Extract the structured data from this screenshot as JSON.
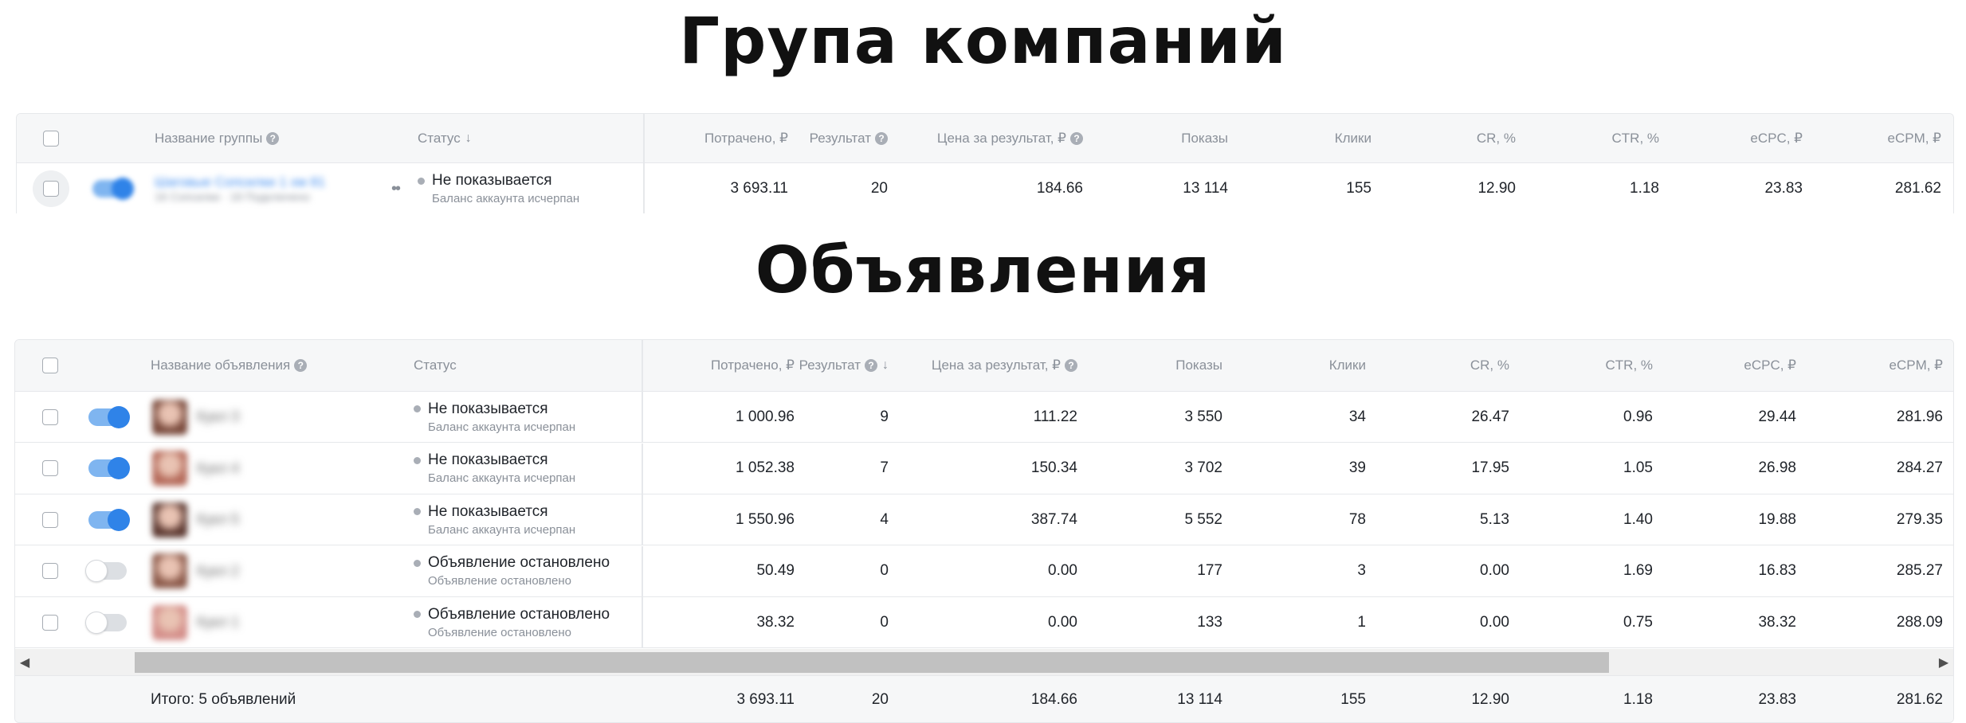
{
  "headings": {
    "campaign_groups": "Група компаний",
    "ads": "Объявления"
  },
  "groups_table": {
    "columns": {
      "name": "Название группы",
      "status": "Статус",
      "spent": "Потрачено, ₽",
      "result": "Результат",
      "price_per_result": "Цена за результат, ₽",
      "impressions": "Показы",
      "clicks": "Клики",
      "cr": "CR, %",
      "ctr": "CTR, %",
      "ecpc": "eCPC, ₽",
      "ecpm": "eCPM, ₽"
    },
    "sort_indicator": "↓",
    "rows": [
      {
        "name_blurred": "Шаговые Сопсилки 1 хм 81",
        "sub_blurred": "16 Сопсилки · 18 Подключено",
        "enabled": true,
        "status": "Не показывается",
        "status_sub": "Баланс аккаунта исчерпан",
        "spent": "3 693.11",
        "result": "20",
        "price_per_result": "184.66",
        "impressions": "13 114",
        "clicks": "155",
        "cr": "12.90",
        "ctr": "1.18",
        "ecpc": "23.83",
        "ecpm": "281.62"
      }
    ]
  },
  "ads_table": {
    "columns": {
      "name": "Название объявления",
      "status": "Статус",
      "spent": "Потрачено, ₽",
      "result": "Результат",
      "price_per_result": "Цена за результат, ₽",
      "impressions": "Показы",
      "clicks": "Клики",
      "cr": "CR, %",
      "ctr": "CTR, %",
      "ecpc": "eCPC, ₽",
      "ecpm": "eCPM, ₽"
    },
    "sort_indicator": "↓",
    "rows": [
      {
        "name_blurred": "Кукл 3",
        "thumb_color": "#7a4a3c",
        "enabled": true,
        "status": "Не показывается",
        "status_sub": "Баланс аккаунта исчерпан",
        "spent": "1 000.96",
        "result": "9",
        "price_per_result": "111.22",
        "impressions": "3 550",
        "clicks": "34",
        "cr": "26.47",
        "ctr": "0.96",
        "ecpc": "29.44",
        "ecpm": "281.96"
      },
      {
        "name_blurred": "Кукл 4",
        "thumb_color": "#b56a5a",
        "enabled": true,
        "status": "Не показывается",
        "status_sub": "Баланс аккаунта исчерпан",
        "spent": "1 052.38",
        "result": "7",
        "price_per_result": "150.34",
        "impressions": "3 702",
        "clicks": "39",
        "cr": "17.95",
        "ctr": "1.05",
        "ecpc": "26.98",
        "ecpm": "284.27"
      },
      {
        "name_blurred": "Кукл 5",
        "thumb_color": "#5e3a32",
        "enabled": true,
        "status": "Не показывается",
        "status_sub": "Баланс аккаунта исчерпан",
        "spent": "1 550.96",
        "result": "4",
        "price_per_result": "387.74",
        "impressions": "5 552",
        "clicks": "78",
        "cr": "5.13",
        "ctr": "1.40",
        "ecpc": "19.88",
        "ecpm": "279.35"
      },
      {
        "name_blurred": "Кукл 2",
        "thumb_color": "#8c5a4a",
        "enabled": false,
        "status": "Объявление остановлено",
        "status_sub": "Объявление остановлено",
        "spent": "50.49",
        "result": "0",
        "price_per_result": "0.00",
        "impressions": "177",
        "clicks": "3",
        "cr": "0.00",
        "ctr": "1.69",
        "ecpc": "16.83",
        "ecpm": "285.27"
      },
      {
        "name_blurred": "Кукл 1",
        "thumb_color": "#d48f8a",
        "enabled": false,
        "status": "Объявление остановлено",
        "status_sub": "Объявление остановлено",
        "spent": "38.32",
        "result": "0",
        "price_per_result": "0.00",
        "impressions": "133",
        "clicks": "1",
        "cr": "0.00",
        "ctr": "0.75",
        "ecpc": "38.32",
        "ecpm": "288.09"
      }
    ],
    "totals": {
      "label": "Итого: 5 объявлений",
      "spent": "3 693.11",
      "result": "20",
      "price_per_result": "184.66",
      "impressions": "13 114",
      "clicks": "155",
      "cr": "12.90",
      "ctr": "1.18",
      "ecpc": "23.83",
      "ecpm": "281.62"
    }
  },
  "icons": {
    "help": "help-circle-icon",
    "sort": "sort-down-icon",
    "status_dot": "status-dot-icon",
    "more": "more-dots-icon",
    "scroll_left": "scroll-left-arrow-icon",
    "scroll_right": "scroll-right-arrow-icon"
  }
}
